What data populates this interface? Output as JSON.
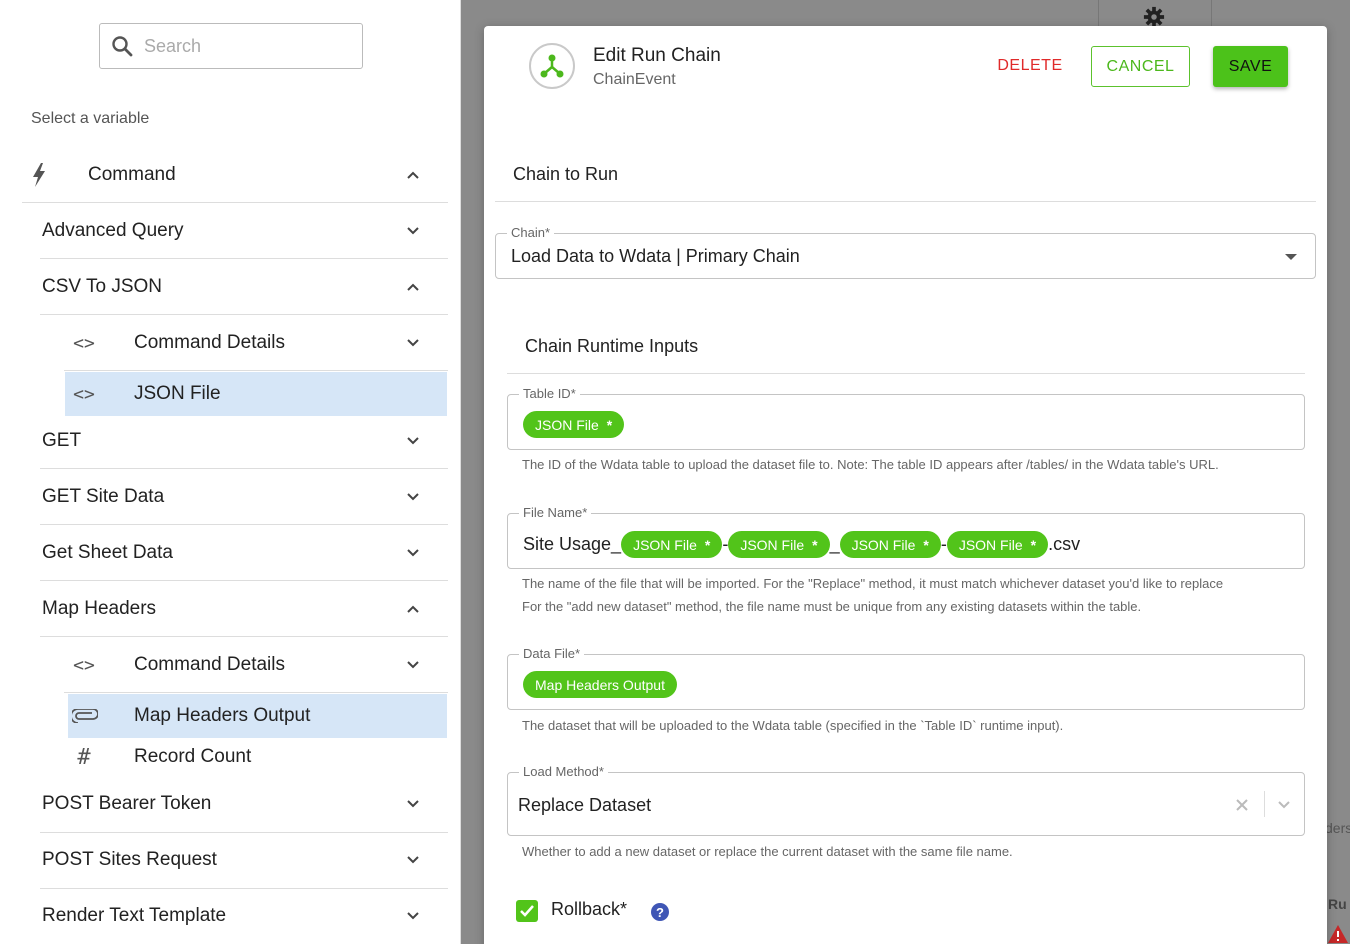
{
  "sidebar": {
    "search_placeholder": "Search",
    "select_label": "Select a variable",
    "command_label": "Command",
    "groups": {
      "advanced_query": "Advanced Query",
      "csv_to_json": "CSV To JSON",
      "csv_command_details": "Command Details",
      "csv_json_file": "JSON File",
      "get": "GET",
      "get_site_data": "GET Site Data",
      "get_sheet_data": "Get Sheet Data",
      "map_headers": "Map Headers",
      "map_command_details": "Command Details",
      "map_headers_output": "Map Headers Output",
      "record_count": "Record Count",
      "post_bearer_token": "POST Bearer Token",
      "post_sites_request": "POST Sites Request",
      "render_text_template": "Render Text Template"
    }
  },
  "modal": {
    "title": "Edit Run Chain",
    "subtitle": "ChainEvent",
    "delete_label": "DELETE",
    "cancel_label": "CANCEL",
    "save_label": "SAVE",
    "chain_section": "Chain to Run",
    "chain_field_label": "Chain*",
    "chain_value": "Load Data to Wdata | Primary Chain",
    "runtime_section": "Chain Runtime Inputs",
    "table_id": {
      "label": "Table ID*",
      "chip": "JSON File",
      "helper": "The ID of the Wdata table to upload the dataset file to. Note: The table ID appears after /tables/ in the Wdata table's URL."
    },
    "file_name": {
      "label": "File Name*",
      "prefix": "Site Usage_",
      "chip1": "JSON File",
      "sep1": "-",
      "chip2": "JSON File",
      "sep2": "_",
      "chip3": "JSON File",
      "sep3": "-",
      "chip4": "JSON File",
      "suffix": ".csv",
      "helper1": "The name of the file that will be imported. For the \"Replace\" method, it must match whichever dataset you'd like to replace",
      "helper2": "For the \"add new dataset\" method, the file name must be unique from any existing datasets within the table."
    },
    "data_file": {
      "label": "Data File*",
      "chip": "Map Headers Output",
      "helper": "The dataset that will be uploaded to the Wdata table (specified in the `Table ID` runtime input)."
    },
    "load_method": {
      "label": "Load Method*",
      "value": "Replace Dataset",
      "helper": "Whether to add a new dataset or replace the current dataset with the same file name."
    },
    "rollback_label": "Rollback*",
    "help_glyph": "?"
  },
  "background": {
    "text1": "ders",
    "text2": "Ru"
  },
  "colors": {
    "accent_green": "#52c41a",
    "delete_red": "#e02a2a",
    "highlight_blue": "#d6e6f7",
    "help_blue": "#3f56b5"
  },
  "icons": {
    "search": "search-icon",
    "command": "lightning-icon",
    "code": "code-icon",
    "attachment": "paperclip-icon",
    "hash": "hash-icon",
    "chain": "chain-event-icon",
    "settings": "gear-icon",
    "help": "help-icon"
  }
}
